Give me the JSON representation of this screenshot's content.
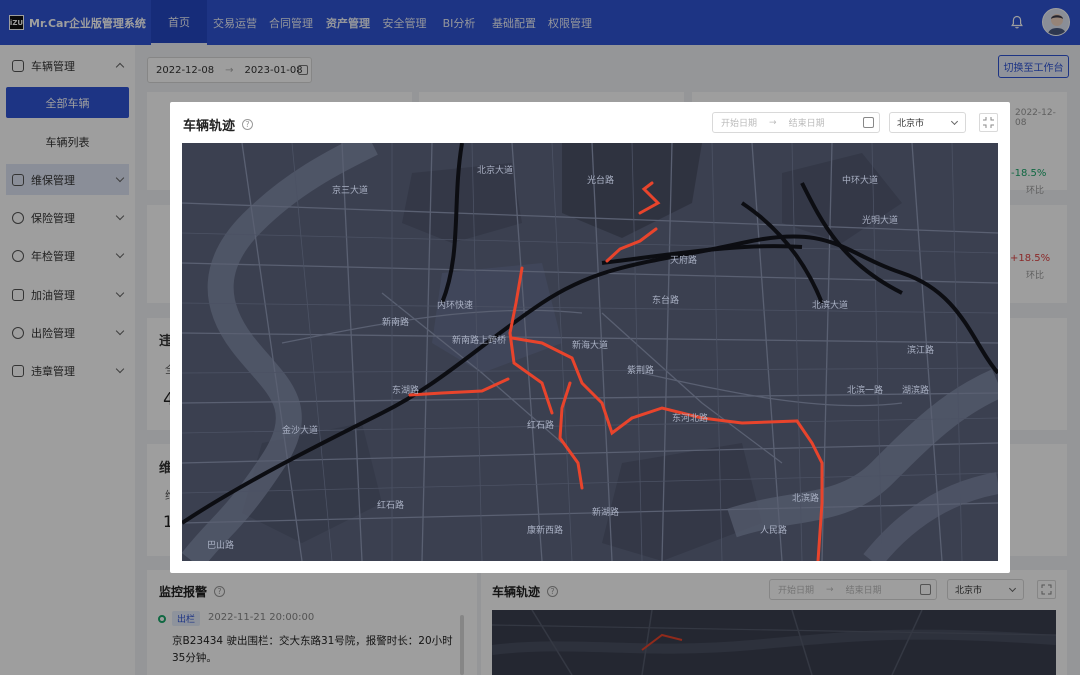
{
  "app": {
    "logo_text": "iZU",
    "title": "Mr.Car企业版管理系统"
  },
  "nav": [
    "首页",
    "交易运营",
    "合同管理",
    "资产管理",
    "安全管理",
    "BI分析",
    "基础配置",
    "权限管理"
  ],
  "sidebar": {
    "items": [
      {
        "label": "车辆管理",
        "icon": "car-icon"
      },
      {
        "label": "全部车辆"
      },
      {
        "label": "车辆列表"
      },
      {
        "label": "维保管理",
        "icon": "maintenance-icon"
      },
      {
        "label": "保险管理",
        "icon": "insurance-icon"
      },
      {
        "label": "年检管理",
        "icon": "inspection-icon"
      },
      {
        "label": "加油管理",
        "icon": "fuel-icon"
      },
      {
        "label": "出险管理",
        "icon": "accident-icon"
      },
      {
        "label": "违章管理",
        "icon": "violation-icon"
      }
    ]
  },
  "toolbar": {
    "date_start": "2022-12-08",
    "date_end": "2023-01-08",
    "switch_label": "切换至工作台"
  },
  "background": {
    "stat1": "-18.5%",
    "stat1_label": "环比",
    "stat2": "+18.5%",
    "stat2_label": "环比",
    "date_right": "2022-12-08",
    "sec1": "违",
    "sec1_sub": "全",
    "sec1_num": "4",
    "sec2": "维",
    "sec2_sub": "维",
    "sec2_num": "1"
  },
  "modal": {
    "title": "车辆轨迹",
    "start_placeholder": "开始日期",
    "end_placeholder": "结束日期",
    "city": "北京市"
  },
  "map_labels": [
    "北京大道",
    "京三大道",
    "光台路",
    "内环快速",
    "新南路",
    "新南路上跨桥",
    "新海大道",
    "东台路",
    "紫荆路",
    "天府路",
    "红石路",
    "红石路",
    "东河北路",
    "北滨路",
    "北滨一路",
    "人民路",
    "东湖路",
    "新湖路",
    "滨江路",
    "中环大道",
    "光明大道",
    "湖滨路",
    "康新西路",
    "北滨大道",
    "金沙大道",
    "巴山路"
  ],
  "alarm": {
    "title": "监控报警",
    "tag": "出栏",
    "time": "2022-11-21 20:00:00",
    "text": "京B23434 驶出围栏：交大东路31号院，报警时长：20小时35分钟。"
  },
  "bottom_track": {
    "title": "车辆轨迹",
    "start_placeholder": "开始日期",
    "end_placeholder": "结束日期",
    "city": "北京市"
  },
  "colors": {
    "primary": "#2f54d6",
    "route": "#e8442c",
    "map_bg": "#3b4050",
    "positive": "#1aa86b",
    "negative": "#e04444"
  }
}
